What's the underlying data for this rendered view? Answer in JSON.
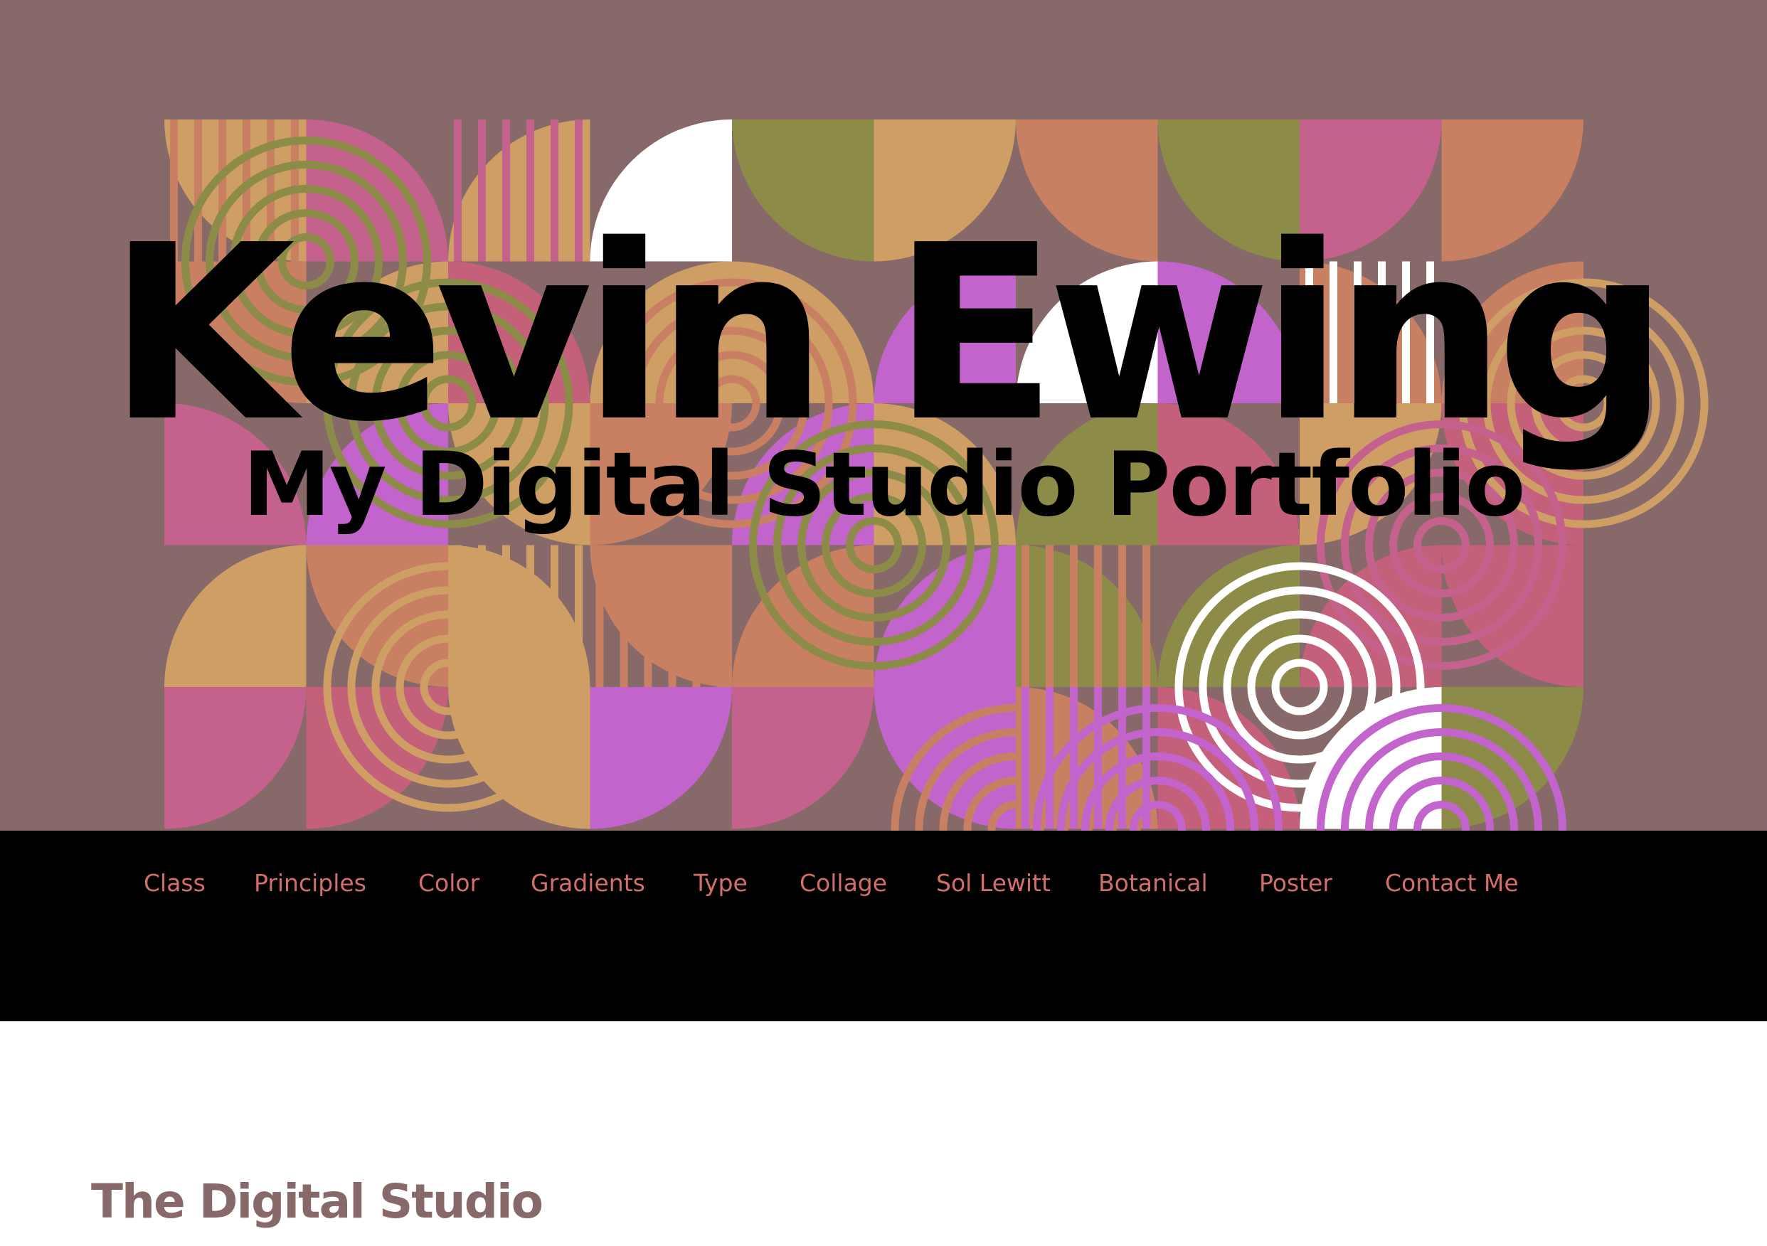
{
  "hero": {
    "title": "Kevin Ewing",
    "tagline": "My Digital Studio Portfolio",
    "pattern_colors": {
      "background": "#87696a",
      "tan": "#cf9e64",
      "coral": "#c87f62",
      "pink": "#c5618d",
      "rose": "#c4607a",
      "olive": "#8c8b48",
      "violet": "#c364cc",
      "white": "#ffffff"
    }
  },
  "nav": {
    "items": [
      {
        "label": "Class"
      },
      {
        "label": "Principles"
      },
      {
        "label": "Color"
      },
      {
        "label": "Gradients"
      },
      {
        "label": "Type"
      },
      {
        "label": "Collage"
      },
      {
        "label": "Sol Lewitt"
      },
      {
        "label": "Botanical"
      },
      {
        "label": "Poster"
      },
      {
        "label": "Contact Me"
      }
    ],
    "link_color": "#d36f6a",
    "background": "#000000"
  },
  "content": {
    "section_heading": "The Digital Studio",
    "heading_color": "#87696a"
  }
}
